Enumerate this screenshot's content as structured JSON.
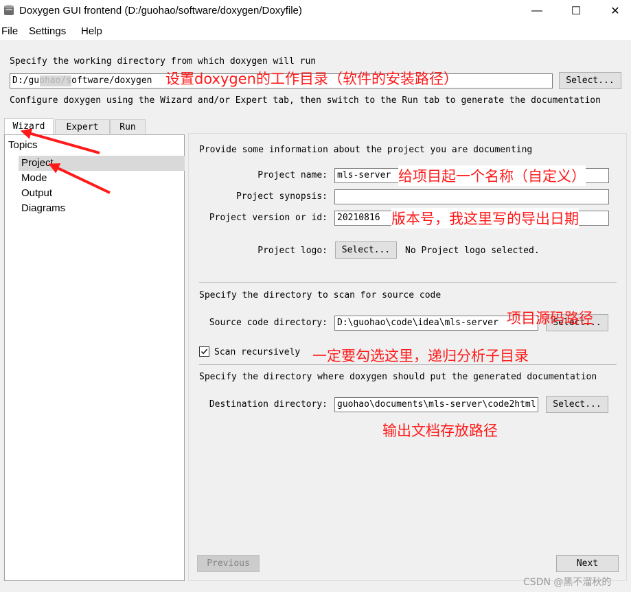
{
  "window": {
    "title": "Doxygen GUI frontend (D:/guohao/software/doxygen/Doxyfile)",
    "minimize": "—",
    "maximize": "☐",
    "close": "✕"
  },
  "menu": {
    "file": "File",
    "settings": "Settings",
    "help": "Help"
  },
  "top": {
    "workdir_label": "Specify the working directory from which doxygen will run",
    "workdir_value": "D:/guohao/software/doxygen",
    "workdir_select": "Select...",
    "configure_text": "Configure doxygen using the Wizard and/or Expert tab, then switch to the Run tab to generate the documentation"
  },
  "tabs": {
    "wizard": "Wizard",
    "expert": "Expert",
    "run": "Run"
  },
  "sidebar": {
    "heading": "Topics",
    "items": [
      "Project",
      "Mode",
      "Output",
      "Diagrams"
    ],
    "selected": "Project"
  },
  "project": {
    "intro": "Provide some information about the project you are documenting",
    "name_label": "Project name:",
    "name_value": "mls-server",
    "synopsis_label": "Project synopsis:",
    "synopsis_value": "",
    "version_label": "Project version or id:",
    "version_value": "20210816",
    "logo_label": "Project logo:",
    "logo_select": "Select...",
    "logo_status": "No Project logo selected."
  },
  "source": {
    "heading": "Specify the directory to scan for source code",
    "dir_label": "Source code directory:",
    "dir_value": "D:\\guohao\\code\\idea\\mls-server",
    "dir_select": "Select...",
    "recursive_label": "Scan recursively",
    "recursive_checked": true
  },
  "destination": {
    "heading": "Specify the directory where doxygen should put the generated documentation",
    "dir_label": "Destination directory:",
    "dir_value": "guohao\\documents\\mls-server\\code2html",
    "dir_select": "Select..."
  },
  "nav": {
    "previous": "Previous",
    "next": "Next"
  },
  "annotations": {
    "workdir": "设置doxygen的工作目录（软件的安装路径）",
    "name": "给项目起一个名称（自定义）",
    "version": "版本号，我这里写的导出日期",
    "source": "项目源码路径",
    "recursive": "一定要勾选这里，递归分析子目录",
    "output": "输出文档存放路径"
  },
  "watermark": "CSDN @黑不溜秋的",
  "colors": {
    "annotation": "#ff1a1a",
    "selection": "#d9d9d9"
  }
}
